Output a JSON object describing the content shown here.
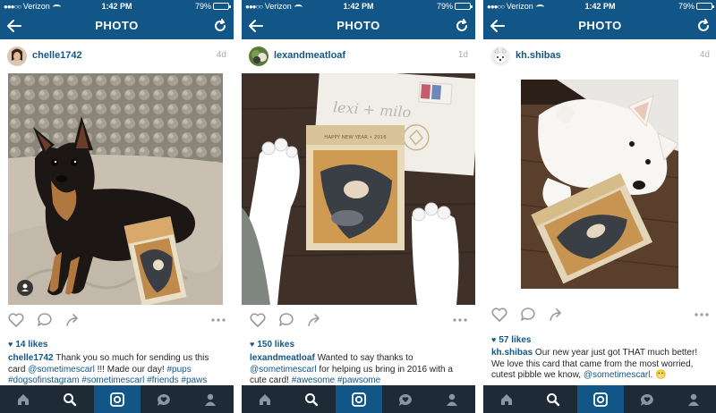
{
  "status": {
    "carrier": "Verizon",
    "time": "1:42 PM",
    "battery": "79%"
  },
  "header": {
    "title": "PHOTO"
  },
  "icons": {
    "back": "back-arrow-icon",
    "refresh": "refresh-icon",
    "like": "heart-icon",
    "comment": "comment-icon",
    "share": "share-icon",
    "more": "more-icon",
    "tabs": [
      "home-icon",
      "search-icon",
      "camera-icon",
      "activity-icon",
      "profile-icon"
    ]
  },
  "colors": {
    "brand": "#125688",
    "tabbar": "#1e2a36"
  },
  "posts": [
    {
      "username": "chelle1742",
      "age": "4d",
      "likes": "14 likes",
      "caption_user": "chelle1742",
      "caption_text": " Thank you so much for sending us this card ",
      "caption_mention": "@sometimescarl",
      "caption_text2": " !!! Made our day! ",
      "caption_tags": "#pups #dogsofinstagram #sometimescarl #friends #paws"
    },
    {
      "username": "lexandmeatloaf",
      "age": "1d",
      "likes": "150 likes",
      "caption_user": "lexandmeatloaf",
      "caption_text": " Wanted to say thanks to ",
      "caption_mention": "@sometimescarl",
      "caption_text2": " for helping us bring in 2016 with a cute card! ",
      "caption_tags": "#awesome #pawsome"
    },
    {
      "username": "kh.shibas",
      "age": "4d",
      "likes": "57 likes",
      "caption_user": "kh.shibas",
      "caption_text": " Our new year just got THAT much better! We love this card that came from the most worried, cutest pibble we know, ",
      "caption_mention": "@sometimescarl",
      "caption_text2": ". 😬",
      "caption_tags": ""
    }
  ],
  "card_texts": {
    "happy_new_year": "HAPPY NEW YEAR",
    "year": "2016",
    "envelope_names": "lexi + milo"
  }
}
